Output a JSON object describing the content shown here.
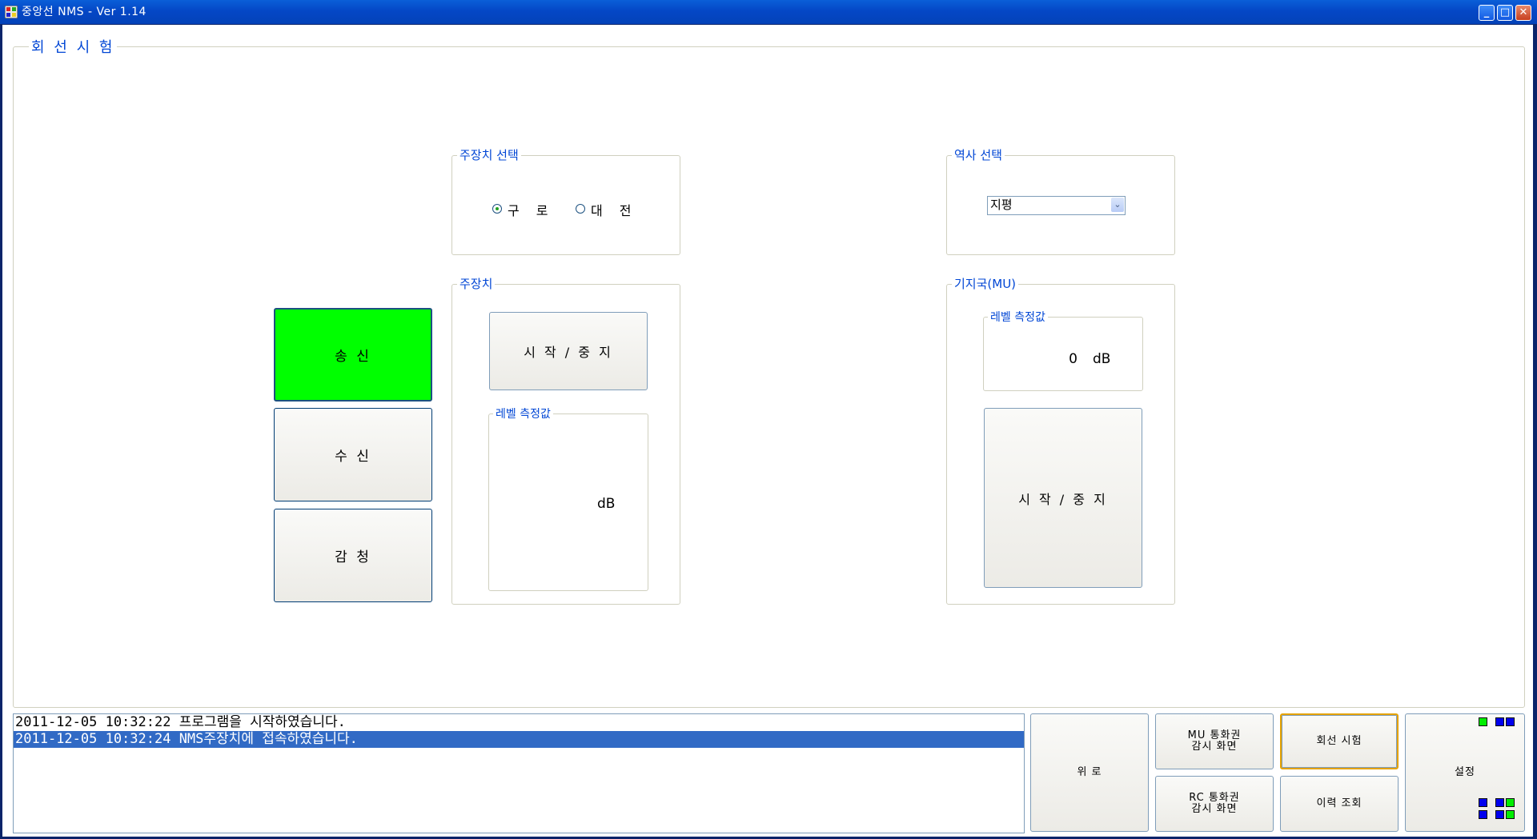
{
  "window": {
    "title": "중앙선 NMS  - Ver 1.14",
    "minimize": "_",
    "maximize": "□",
    "close": "✕"
  },
  "main_group": {
    "title": "회 선 시 험"
  },
  "mode_buttons": [
    {
      "label": "송 신",
      "active": true
    },
    {
      "label": "수 신",
      "active": false
    },
    {
      "label": "감 청",
      "active": false
    }
  ],
  "main_device_select": {
    "title": "주장치 선택",
    "options": [
      {
        "label": "구 로",
        "checked": true
      },
      {
        "label": "대 전",
        "checked": false
      }
    ]
  },
  "main_device": {
    "title": "주장치",
    "start_stop_label": "시 작 / 중 지",
    "level": {
      "title": "레벨 측정값",
      "value": "",
      "unit": "dB"
    }
  },
  "station_select": {
    "title": "역사 선택",
    "selected": "지평",
    "arrow": "⌄"
  },
  "base_station": {
    "title": "기지국(MU)",
    "level": {
      "title": "레벨 측정값",
      "value": "0",
      "unit": "dB"
    },
    "start_stop_label": "시 작 / 중 지"
  },
  "log": [
    {
      "text": "2011-12-05 10:32:22 프로그램을 시작하였습니다.",
      "selected": false
    },
    {
      "text": "2011-12-05 10:32:24 NMS주장치에 접속하였습니다.",
      "selected": true
    }
  ],
  "nav": {
    "comfort": "위 로",
    "mu_monitor_line1": "MU 통화권",
    "mu_monitor_line2": "감시 화면",
    "rc_monitor_line1": "RC 통화권",
    "rc_monitor_line2": "감시 화면",
    "line_test": "회선 시험",
    "history": "이력 조회",
    "settings": "설정"
  },
  "colors": {
    "active_green": "#00ff00",
    "legend_blue": "#0046d5",
    "selection_blue": "#316ac5",
    "titlebar_blue": "#0447c6"
  }
}
